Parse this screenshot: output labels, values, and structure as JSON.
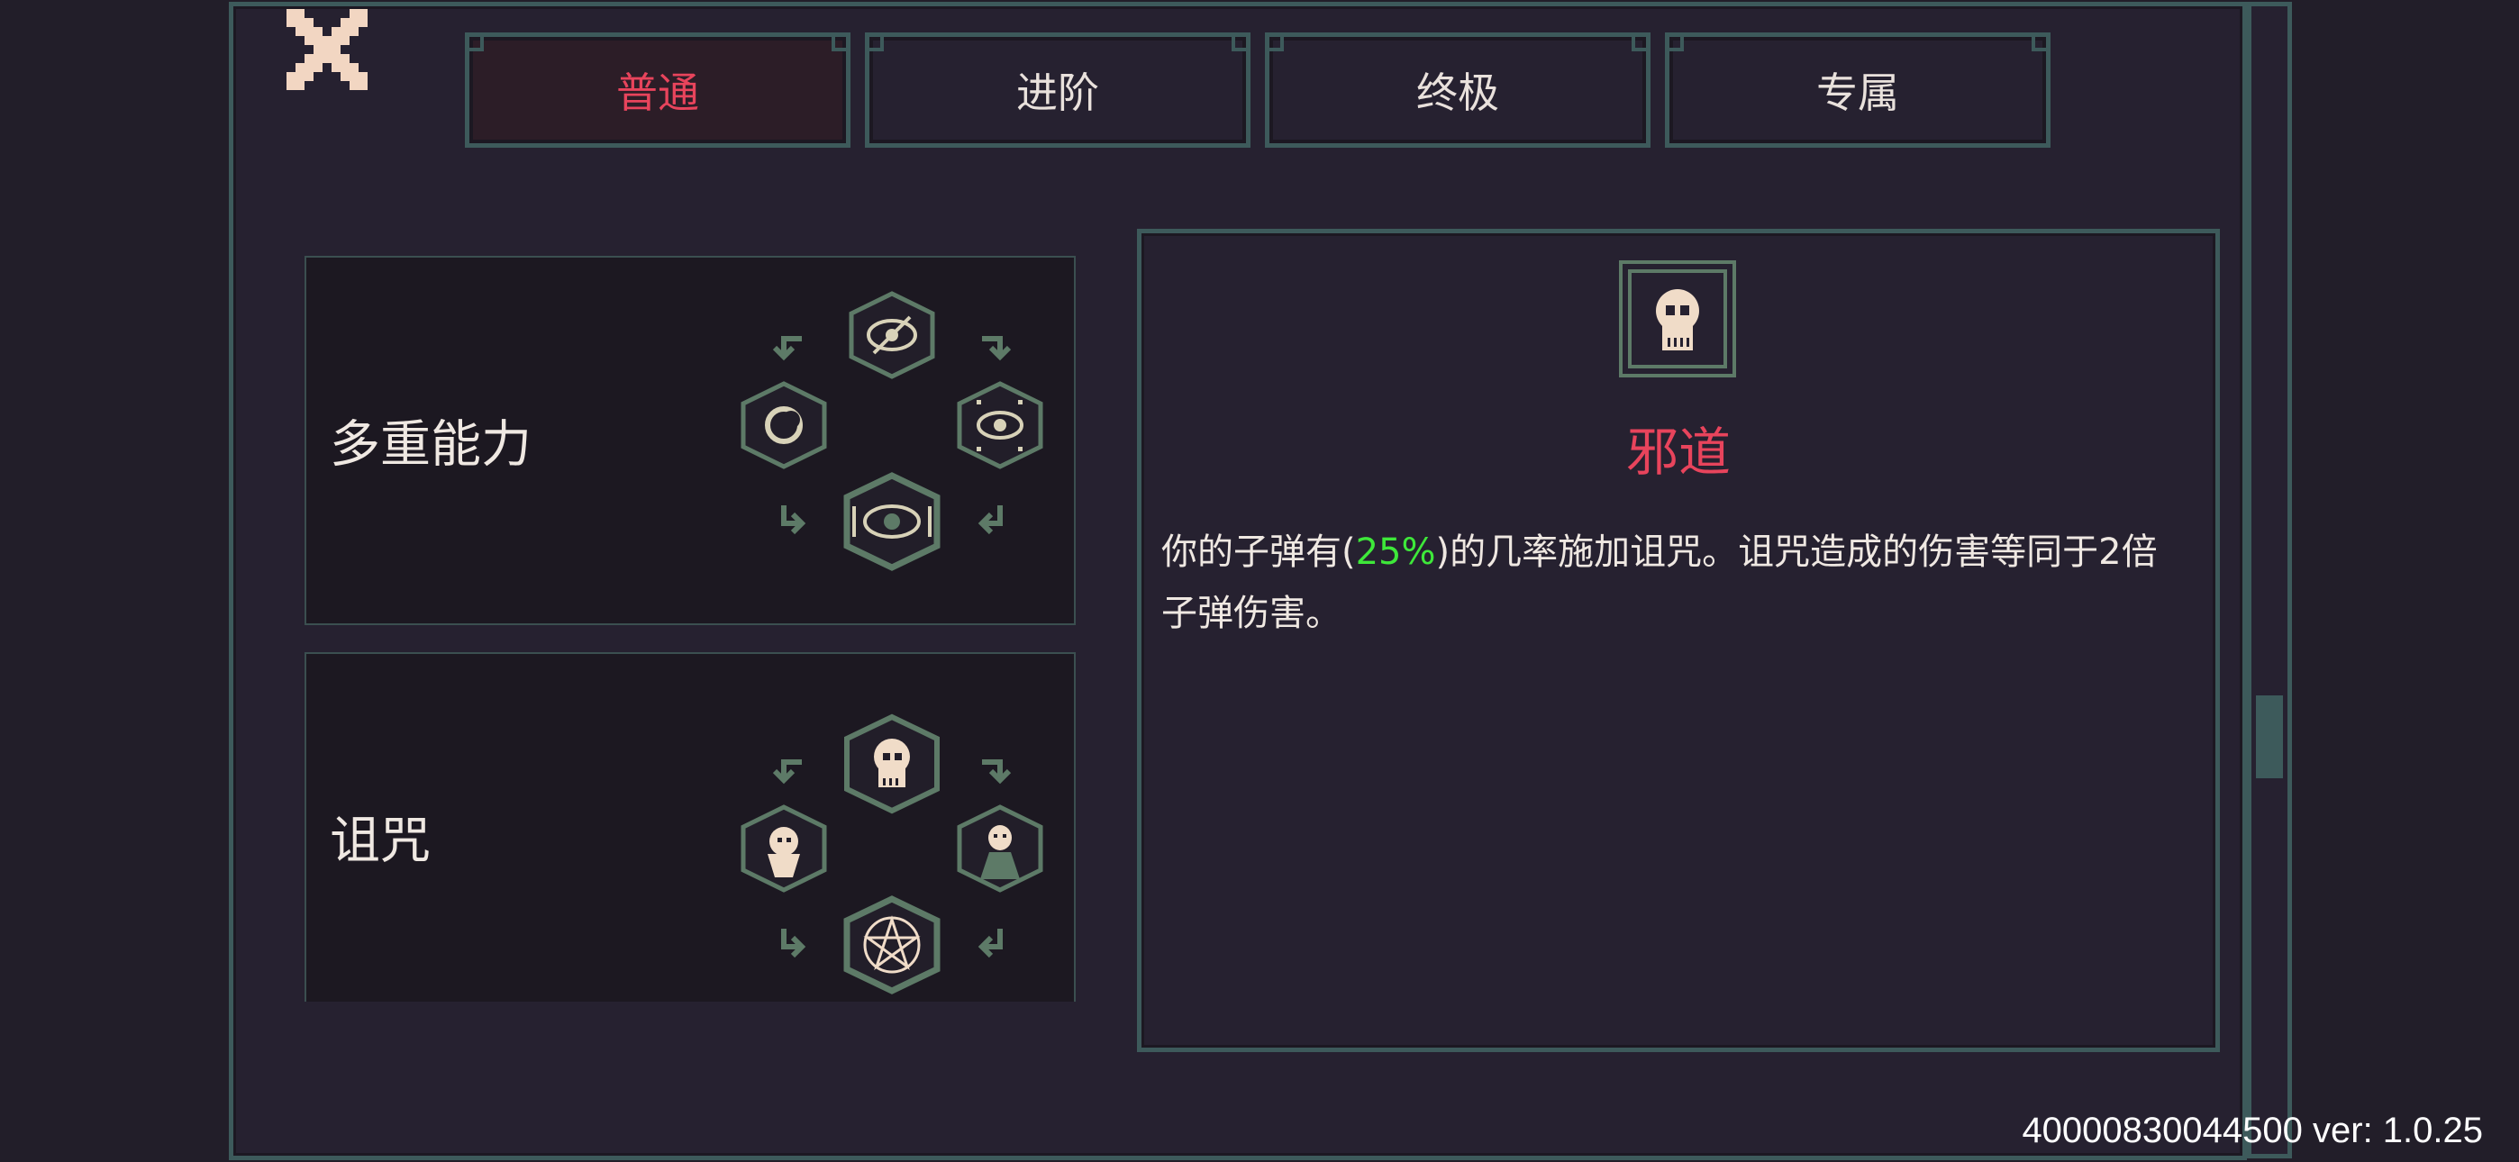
{
  "tabs": [
    {
      "label": "普通",
      "active": true
    },
    {
      "label": "进阶",
      "active": false
    },
    {
      "label": "终极",
      "active": false
    },
    {
      "label": "专属",
      "active": false
    }
  ],
  "abilities": [
    {
      "label": "多重能力",
      "icons": [
        "eye-slash-icon",
        "moon-eye-icon",
        "sparkle-eye-icon",
        "eye-icon"
      ]
    },
    {
      "label": "诅咒",
      "icons": [
        "skull-icon",
        "ghost-icon",
        "hooded-figure-icon",
        "pentagram-icon"
      ]
    }
  ],
  "detail": {
    "portrait_icon": "skull-icon",
    "title": "邪道",
    "desc_before": "你的子弹有(",
    "desc_highlight": "25%",
    "desc_after": ")的几率施加诅咒。诅咒造成的伤害等同于2倍子弹伤害。"
  },
  "version": "40000830044500 ver: 1.0.25",
  "colors": {
    "background": "#221e29",
    "panel": "#262130",
    "border": "#3d5a5b",
    "accent_red": "#e8445c",
    "highlight_green": "#3ee83a",
    "text": "#efe8e2",
    "icon_stroke": "#5d7a67",
    "icon_light": "#f0dcc8"
  }
}
